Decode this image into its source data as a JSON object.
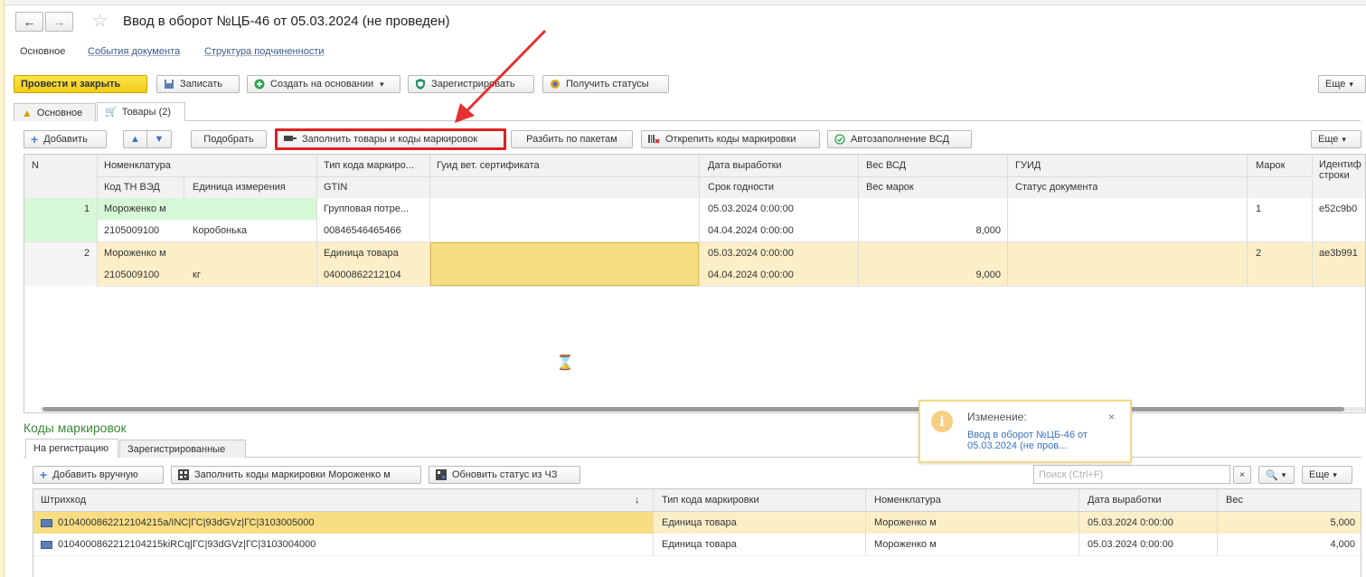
{
  "window": {
    "title": "Ввод в оборот №ЦБ-46 от 05.03.2024 (не проведен)"
  },
  "nav_links": [
    "Основное",
    "События документа",
    "Структура подчиненности"
  ],
  "toolbar": {
    "post_close": "Провести и закрыть",
    "save": "Записать",
    "create_based": "Создать на основании",
    "register": "Зарегистрировать",
    "get_statuses": "Получить статусы",
    "more": "Еще"
  },
  "tabs": [
    "Основное",
    "Товары (2)"
  ],
  "goods_toolbar": {
    "add": "Добавить",
    "pick": "Подобрать",
    "fill_goods": "Заполнить товары и коды маркировок",
    "split": "Разбить по пакетам",
    "detach": "Открепить коды маркировки",
    "autofill": "Автозаполнение ВСД",
    "more": "Еще"
  },
  "goods_table": {
    "headers_top": [
      "N",
      "Номенклатура",
      "Тип кода маркиро...",
      "Гуид вет. сертификата",
      "Дата выработки",
      "Вес ВСД",
      "ГУИД",
      "Марок",
      "Идентиф строки"
    ],
    "headers_bottom": [
      "Код ТН ВЭД",
      "Единица измерения",
      "GTIN",
      "Срок годности",
      "Вес марок",
      "Статус документа"
    ],
    "rows": [
      {
        "n": "1",
        "nomenclature": "Мороженко м",
        "code_type": "Групповая потре...",
        "prod_date": "05.03.2024 0:00:00",
        "marks": "1",
        "ident": "e52c9b0",
        "tnved": "2105009100",
        "unit": "Коробонька",
        "gtin": "00846546465466",
        "expiry": "04.04.2024 0:00:00",
        "weight_marks": "8,000"
      },
      {
        "n": "2",
        "nomenclature": "Мороженко м",
        "code_type": "Единица товара",
        "prod_date": "05.03.2024 0:00:00",
        "marks": "2",
        "ident": "ae3b991",
        "tnved": "2105009100",
        "unit": "кг",
        "gtin": "04000862212104",
        "expiry": "04.04.2024 0:00:00",
        "weight_marks": "9,000"
      }
    ]
  },
  "codes_section": {
    "title": "Коды маркировок",
    "tabs": [
      "На регистрацию",
      "Зарегистрированные"
    ],
    "add_manual": "Добавить вручную",
    "fill_codes": "Заполнить коды маркировки Мороженко м",
    "update_status": "Обновить статус из ЧЗ",
    "search_placeholder": "Поиск (Ctrl+F)",
    "more": "Еще",
    "headers": [
      "Штрихкод",
      "Тип кода маркировки",
      "Номенклатура",
      "Дата выработки",
      "Вес"
    ],
    "sort_arrow": "↓",
    "rows": [
      {
        "barcode": "0104000862212104215a/INC|ГС|93dGVz|ГС|3103005000",
        "type": "Единица товара",
        "nomenclature": "Мороженко м",
        "date": "05.03.2024 0:00:00",
        "weight": "5,000"
      },
      {
        "barcode": "0104000862212104215kiRCq|ГС|93dGVz|ГС|3103004000",
        "type": "Единица товара",
        "nomenclature": "Мороженко м",
        "date": "05.03.2024 0:00:00",
        "weight": "4,000"
      }
    ]
  },
  "notification": {
    "title": "Изменение:",
    "link": "Ввод в оборот №ЦБ-46 от 05.03.2024 (не пров..."
  },
  "colors": {
    "accent_yellow": "#f5d22a",
    "row_selected": "#fbefc8",
    "row_new": "#d7f8d7",
    "highlight_red": "#e53030"
  }
}
